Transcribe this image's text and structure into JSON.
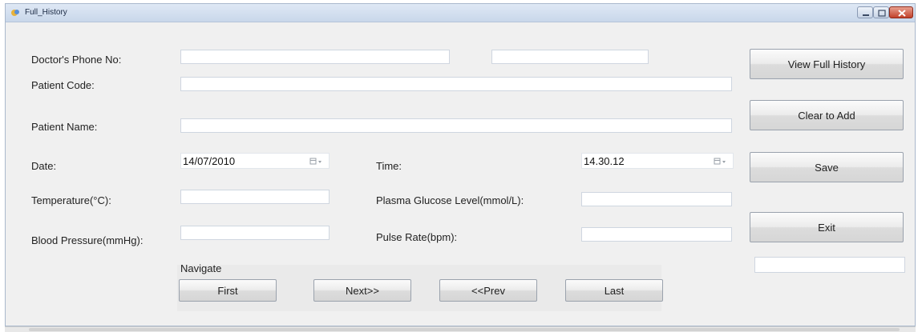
{
  "window": {
    "title": "Full_History",
    "min_icon": "minimize-icon",
    "max_icon": "maximize-icon",
    "close_icon": "close-icon"
  },
  "labels": {
    "doctor_phone": "Doctor's Phone No:",
    "patient_code": "Patient Code:",
    "patient_name": "Patient Name:",
    "date": "Date:",
    "time": "Time:",
    "temperature": "Temperature(°C):",
    "plasma_glucose": "Plasma Glucose Level(mmol/L):",
    "blood_pressure": "Blood Pressure(mmHg):",
    "pulse_rate": "Pulse Rate(bpm):",
    "navigate": "Navigate"
  },
  "fields": {
    "doctor_phone": "",
    "doctor_phone_extra": "",
    "patient_code": "",
    "patient_name": "",
    "date": "14/07/2010",
    "time": "14.30.12",
    "temperature": "",
    "plasma_glucose": "",
    "blood_pressure": "",
    "pulse_rate": "",
    "status": ""
  },
  "buttons": {
    "view_full_history": "View Full History",
    "clear_to_add": "Clear to Add",
    "save": "Save",
    "exit": "Exit",
    "first": "First",
    "next": "Next>>",
    "prev": "<<Prev",
    "last": "Last"
  }
}
